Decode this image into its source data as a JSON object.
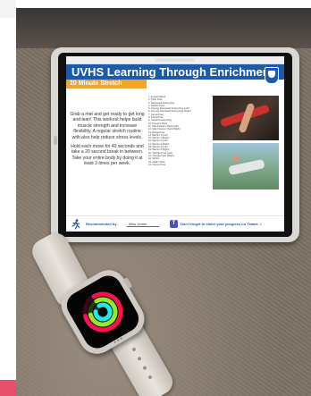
{
  "poster": {
    "title": "UVHS Learning Through Enrichment",
    "subtitle": "20 Minute Stretch",
    "intro": "Grab a mat and get ready to get long and lean! This workout helps build muscle strength and increase flexibility. A regular stretch routine with also help reduce stress levels.",
    "instructions": "Hold each move for 40 seconds and take a 20 second break in between. Take your entire body by doing it at least 3 times per week.",
    "moves": [
      "1. Forward Bend",
      "2. Chair Pose",
      "3. Downward Facing Dog",
      "4. Dolphin Pose",
      "5. One-leg Downward Facing Dog (Left)",
      "6. One-leg Downward Facing Dog (Right)",
      "7. Camel Pose",
      "8. Cobra Pose",
      "9. Upward Facing Dog",
      "10. Forearm Plank",
      "11. Side Forearm Plank (Left)",
      "12. Side Forearm Plank (Right)",
      "13. Bridge Pose",
      "14. Warrior 1 (Left)",
      "15. Warrior 1 (Right)",
      "16. Warrior 2 (Left)",
      "17. Warrior 2 (Right)",
      "18. Warrior 3 (Left)",
      "19. Warrior 3 (Right)",
      "20. Triangle Pose (Left)",
      "21. Triangle Pose (Right)",
      "22. Sphinx",
      "23. Child's Pose",
      "24. Corpse Pose"
    ],
    "footer": {
      "recommended_label": "Recommended by:",
      "recommended_name": "Miss Green",
      "teams_text": "Don't forget to share your progress on Teams ☺"
    }
  },
  "colors": {
    "banner": "#1d5aa8",
    "subtitle_bar": "#f2a52a",
    "move_ring": "#fa114f",
    "exercise_ring": "#92e82a",
    "stand_ring": "#1eeaef"
  },
  "icons": [
    "runner-icon",
    "teams-icon",
    "school-crest-icon"
  ]
}
